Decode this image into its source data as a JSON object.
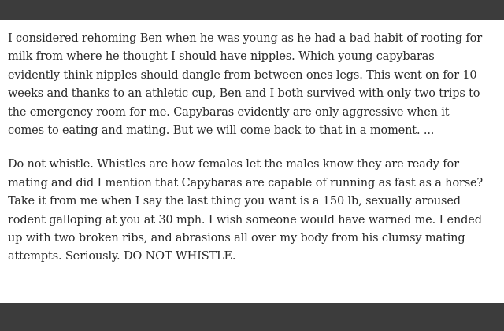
{
  "article": {
    "paragraphs": [
      {
        "lines": [
          "I considered rehoming Ben when he was young as he had a bad habit of rooting for",
          "milk from where he thought I should have nipples. Which young capybaras",
          "evidently think nipples should dangle from between ones legs. This went on for 10",
          "weeks and thanks to an athletic cup, Ben and I both survived with only two trips to",
          "the emergency room for me. Capybaras evidently are only aggressive when it",
          "comes to eating and mating. But we will come back to that in a moment. ..."
        ]
      },
      {
        "lines": [
          "Do not whistle. Whistles are how females let the males know they are ready for",
          "mating and did I mention that Capybaras are capable of running as fast as a horse?",
          "Take it from me when I say the last thing you want is a 150 lb, sexually aroused",
          "rodent galloping at you at 30 mph. I wish someone would have warned me. I ended",
          "up with two broken ribs, and abrasions all over my body from his clumsy mating",
          "attempts. Seriously. DO NOT WHISTLE."
        ]
      }
    ]
  }
}
